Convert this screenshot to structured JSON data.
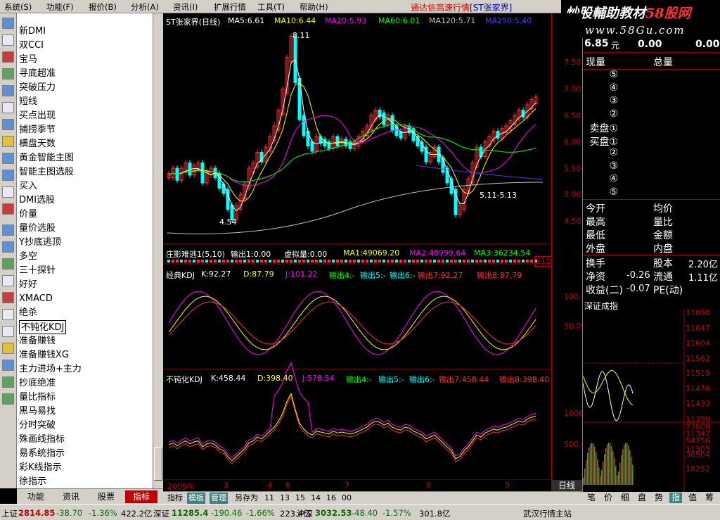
{
  "menu": {
    "items": [
      "系统(S)",
      "功能(F)",
      "报价(B)",
      "分析(A)",
      "资讯(I)",
      "扩展行情",
      "工具(T)",
      "帮助(H)"
    ]
  },
  "title": {
    "text": "通达信高速行情",
    "code": "[ST张家界]"
  },
  "watermark": {
    "line1a": "炒股輔助教材",
    "line1b": "58股网",
    "line2": "www.58Gu.com"
  },
  "indicators": [
    "新DMI",
    "双CCI",
    "宝马",
    "寻底超准",
    "突破压力",
    "短线",
    "买点出现",
    "捕捞季节",
    "横盘天数",
    "黄金智能主图",
    "智能主图选股",
    "买入",
    "DMI选股",
    "价量",
    "量价选股",
    "Y抄底逃顶",
    "多空",
    "三十探针",
    "好好",
    "XMACD",
    "绝杀",
    "不钝化KDJ",
    "准备赚钱",
    "准备赚钱XG",
    "主力进场+主力",
    "抄底绝准",
    "量比指标",
    "黑马易找",
    "分时突破",
    "殊画线指标",
    "易系统指示",
    "彩K线指示",
    "徐指示"
  ],
  "indicator_selected": "不钝化KDJ",
  "list_tabs": [
    "功能",
    "资讯",
    "股票",
    "指标"
  ],
  "main_chart": {
    "name": "ST张家界(日线)",
    "ma": [
      "MA5:6.61",
      "MA10:6.44",
      "MA20:5.93",
      "MA60:6.01",
      "MA120:5.71",
      "MA250:5.40"
    ],
    "ann_high": "8.11",
    "ann_low": "4.54",
    "ann_range": "5.11-5.13",
    "ticks": [
      "7.50",
      "7.00",
      "6.50",
      "6.00",
      "5.50",
      "5.00",
      "4.50"
    ]
  },
  "vol_panel": {
    "name": "庄影难逃1(5,10)",
    "out1": "输出1:0.00",
    "vvol": "虚拟量:0.00",
    "ma1": "MA1:49069.20",
    "ma2": "MA2:48999.64",
    "ma3": "MA3:36234.54",
    "unit": "X10"
  },
  "kdj1": {
    "name": "经典KDJ",
    "k": "K:92.27",
    "d": "D:87.79",
    "j": "J:101.22",
    "o4": "输出4:-",
    "o5": "输出5:-",
    "o6": "输出6:-",
    "o7": "输出7:92.27",
    "o8": "输出8:87.79",
    "ticks": [
      "100.0",
      "50.00"
    ]
  },
  "kdj2": {
    "name": "不钝化KDJ",
    "k": "K:458.44",
    "d": "D:398.40",
    "j": "J:578.54",
    "o4": "输出4:-",
    "o5": "输出5:-",
    "o6": "输出6:-",
    "o7": "输出7:458.44",
    "o8": "输出8:398.40",
    "ticks": [
      "1000",
      "500.0"
    ]
  },
  "dates": [
    "2009年",
    "3",
    "4",
    "6",
    "7",
    "8",
    "9"
  ],
  "period": "日线",
  "bottom_tabs": [
    "指标",
    "模板",
    "管理",
    "另存为",
    "11",
    "13",
    "15",
    "14",
    "16",
    "00"
  ],
  "quote": {
    "price": "6.85",
    "unit": "元",
    "v1": "0.00",
    "v2": "0.00",
    "now_label": "现量",
    "total_label": "总量",
    "levels": [
      "⑤",
      "④",
      "③",
      "②",
      "卖盘①",
      "买盘①",
      "②",
      "③",
      "④",
      "⑤"
    ],
    "row1": [
      "今开",
      "均价"
    ],
    "row2": [
      "最高",
      "量比"
    ],
    "row3": [
      "最低",
      "金额"
    ],
    "row4": [
      "外盘",
      "内盘"
    ],
    "turnover": "换手",
    "share_label": "股本",
    "share_val": "2.20亿",
    "net_label": "净资",
    "net_val": "-0.26",
    "float_label": "流通",
    "float_val": "1.11亿",
    "earn_label": "收益(二)",
    "earn_val": "-0.07",
    "pe_label": "PE(动)"
  },
  "index_mini": {
    "name": "深证成指",
    "prices": [
      "11690",
      "11647",
      "11604",
      "11562",
      "11519",
      "11476",
      "11433",
      "11390",
      "11347",
      "11305"
    ],
    "vols": [
      "73008",
      "54756",
      "36504",
      "18252"
    ]
  },
  "quote_tabs": [
    "笔",
    "价",
    "细",
    "盘",
    "势",
    "指",
    "值",
    "筹"
  ],
  "status": {
    "sh_label": "上证",
    "sh_val": "2814.85",
    "sh_chg": "-38.70",
    "sh_pct": "-1.36%",
    "sh_amt": "422.2亿",
    "sz_label": "深证",
    "sz_val": "11285.4",
    "sz_chg": "-190.46",
    "sz_pct": "-1.66%",
    "sz_amt": "223.4亿",
    "hs_label": "沪深",
    "hs_val": "3032.53",
    "hs_chg": "-48.40",
    "hs_pct": "-1.57%",
    "hs_amt": "301.8亿",
    "server": "武汉行情主站"
  },
  "colors": {
    "up": "#ff3030",
    "down": "#00ffff",
    "ma5": "#ffffff",
    "ma10": "#ffff00",
    "ma20": "#ff00ff",
    "ma60": "#00ff00",
    "ma120": "#c0c0c0",
    "ma250": "#4040ff"
  }
}
